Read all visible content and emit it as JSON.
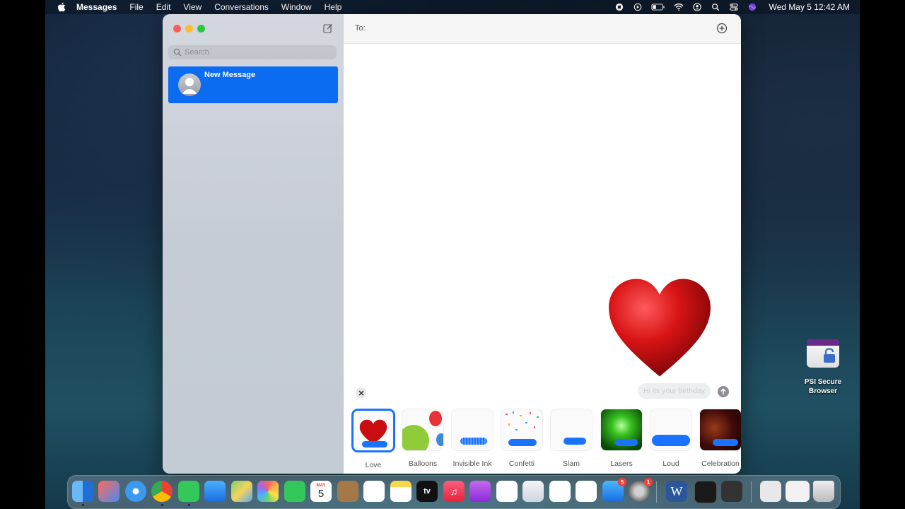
{
  "menubar": {
    "app_name": "Messages",
    "menus": [
      "File",
      "Edit",
      "View",
      "Conversations",
      "Window",
      "Help"
    ],
    "clock": "Wed May 5  12:42 AM"
  },
  "sidebar": {
    "search_placeholder": "Search",
    "conversations": [
      {
        "name": "New Message",
        "selected": true
      }
    ]
  },
  "compose": {
    "to_label": "To:",
    "to_value": "",
    "message_preview": "Hi its your birthday"
  },
  "effects": [
    {
      "label": "Love",
      "selected": true
    },
    {
      "label": "Balloons",
      "selected": false
    },
    {
      "label": "Invisible Ink",
      "selected": false
    },
    {
      "label": "Confetti",
      "selected": false
    },
    {
      "label": "Slam",
      "selected": false
    },
    {
      "label": "Lasers",
      "selected": false
    },
    {
      "label": "Loud",
      "selected": false
    },
    {
      "label": "Celebration",
      "selected": false
    }
  ],
  "desktop": {
    "icons": [
      {
        "label": "PSI Secure Browser"
      }
    ]
  },
  "dock": {
    "calendar_month": "MAY",
    "calendar_day": "5",
    "appstore_badge": "5",
    "settings_badge": "1",
    "word_letter": "W",
    "tv_label": "tv"
  },
  "colors": {
    "accent": "#0b6cf2",
    "heart": "#c80e10"
  }
}
